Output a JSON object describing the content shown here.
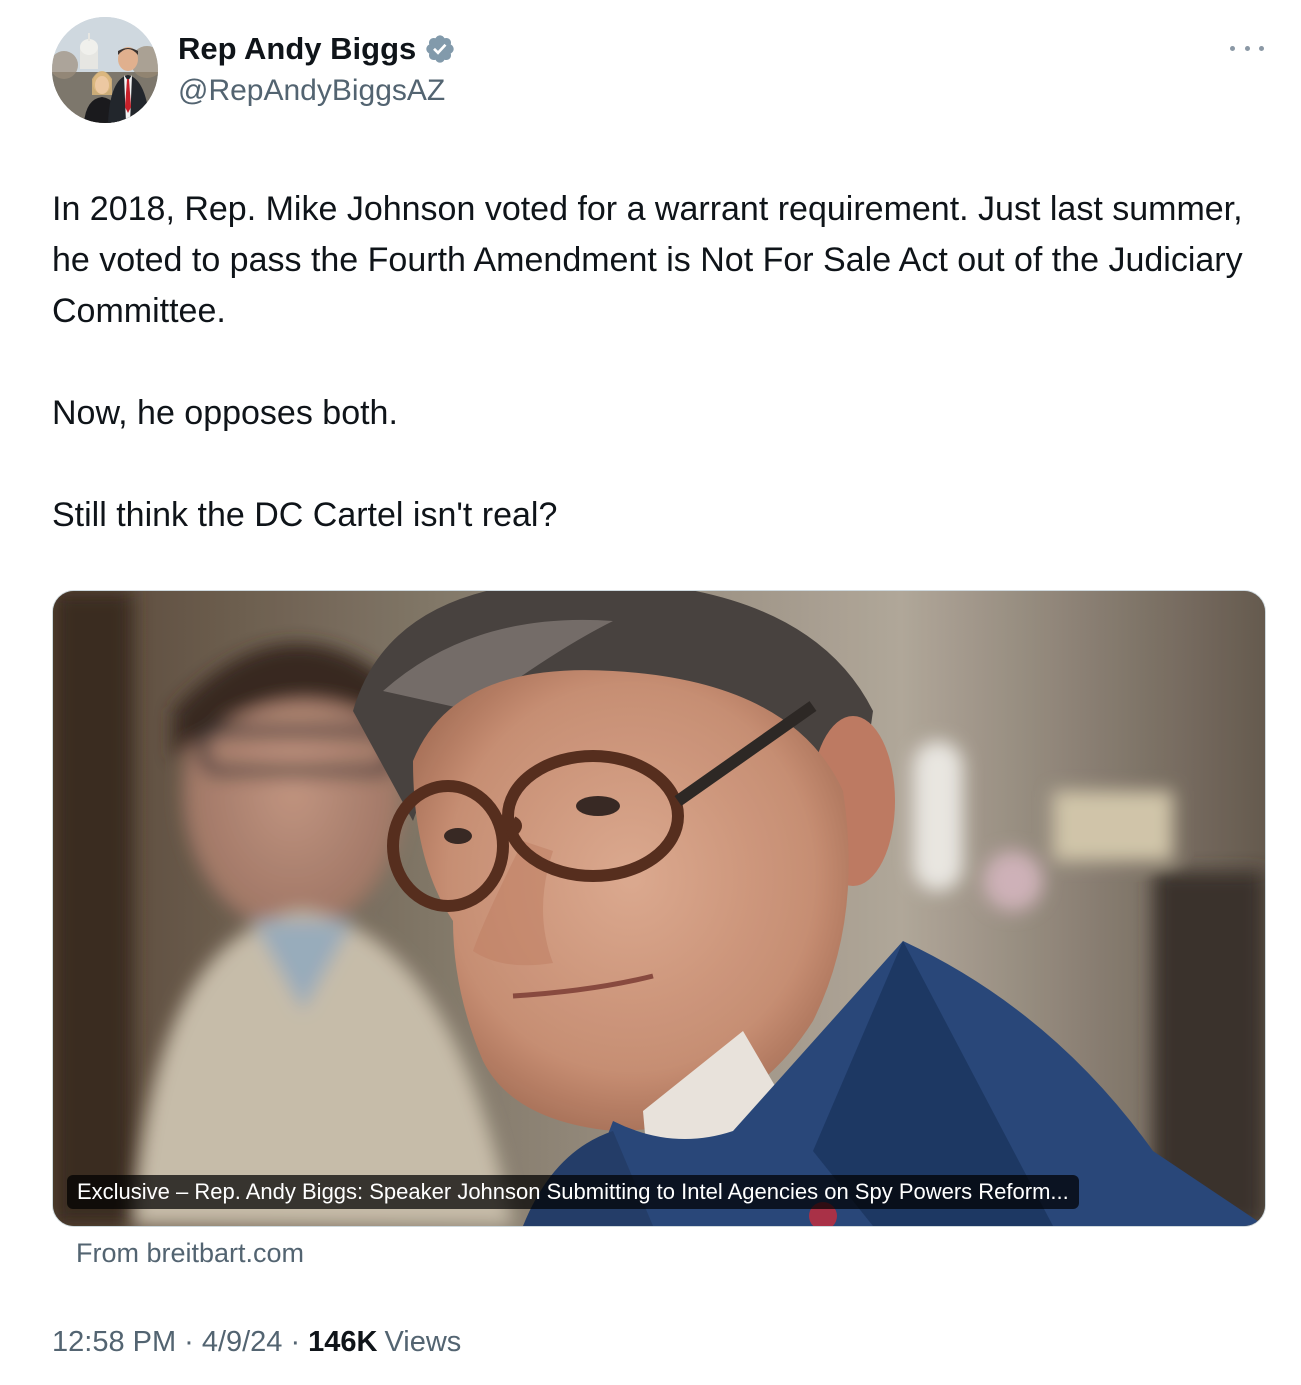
{
  "author": {
    "display_name": "Rep Andy Biggs",
    "handle": "@RepAndyBiggsAZ",
    "verified_color": "#829aab"
  },
  "more_icon": "more-horizontal-icon",
  "tweet": {
    "paragraphs": [
      "In 2018, Rep. Mike Johnson voted for a warrant requirement. Just last summer, he voted to pass the Fourth Amendment is Not For Sale Act out of the Judiciary Committee.",
      "Now, he opposes both.",
      "Still think the DC Cartel isn't real?"
    ]
  },
  "link_card": {
    "caption": "Exclusive – Rep. Andy Biggs: Speaker Johnson Submitting to Intel Agencies on Spy Powers Reform...",
    "source": "From breitbart.com"
  },
  "meta": {
    "time": "12:58 PM",
    "separator": "·",
    "date": "4/9/24",
    "views_count": "146K",
    "views_label": "Views"
  }
}
